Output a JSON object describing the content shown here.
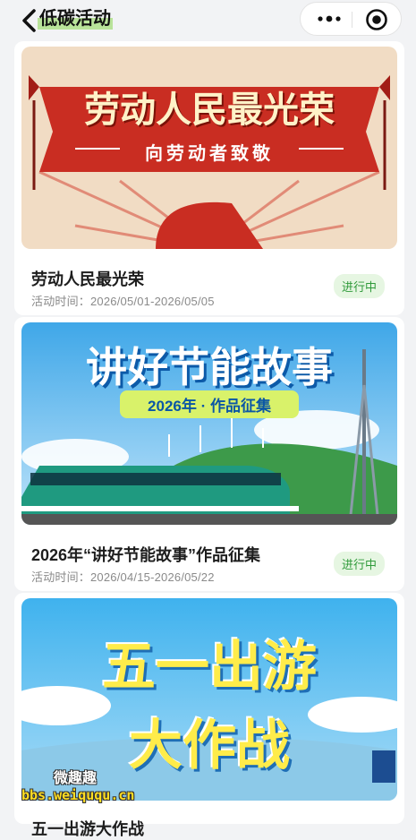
{
  "nav": {
    "title": "低碳活动",
    "back_icon": "chevron-left-icon",
    "more_icon": "more-dots-icon",
    "close_icon": "target-icon"
  },
  "activities": [
    {
      "title": "劳动人民最光荣",
      "time": "活动时间：2026/05/01-2026/05/05",
      "status": "进行中",
      "banner_title": "劳动人民最光荣",
      "banner_subtitle": "向劳动者致敬"
    },
    {
      "title": "2026年“讲好节能故事”作品征集",
      "time": "活动时间：2026/04/15-2026/05/22",
      "status": "进行中",
      "banner_title": "讲好节能故事",
      "banner_subtitle": "2026年 · 作品征集"
    },
    {
      "title": "五一出游大作战",
      "banner_title_line1": "五一出游",
      "banner_title_line2": "大作战"
    }
  ],
  "watermark": {
    "line1": "微趣趣",
    "line2": "bbs.weiququ.cn"
  },
  "colors": {
    "status_bg": "#e6f6e2",
    "status_text": "#2f9a3a",
    "highlight": "#b9e39a"
  }
}
